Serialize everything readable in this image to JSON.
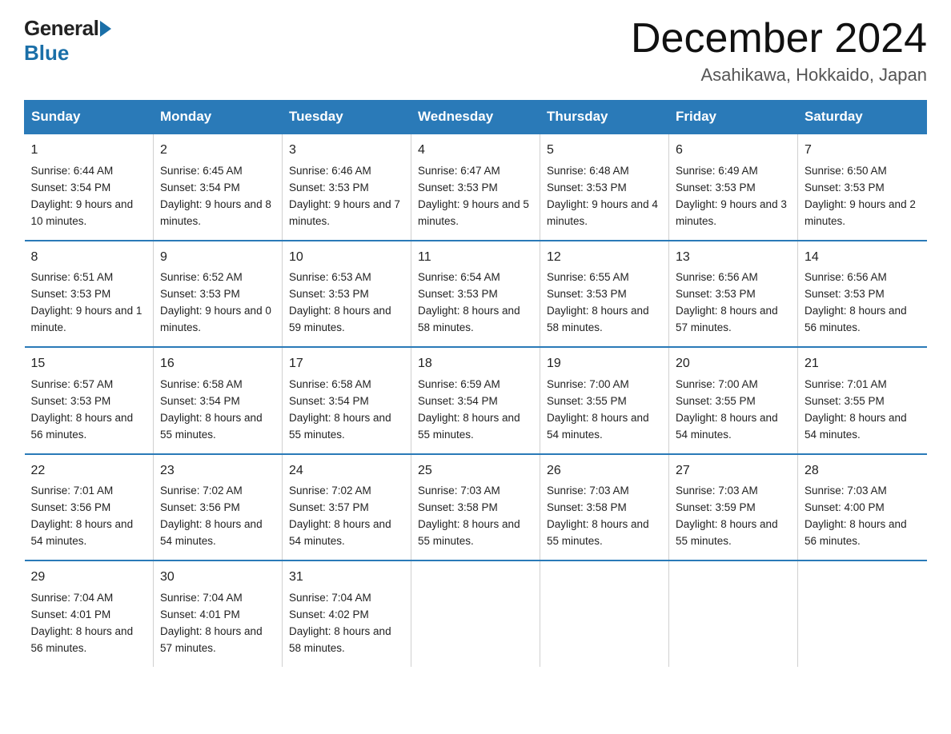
{
  "header": {
    "logo_general": "General",
    "logo_blue": "Blue",
    "month_title": "December 2024",
    "location": "Asahikawa, Hokkaido, Japan"
  },
  "columns": [
    "Sunday",
    "Monday",
    "Tuesday",
    "Wednesday",
    "Thursday",
    "Friday",
    "Saturday"
  ],
  "weeks": [
    [
      {
        "day": "1",
        "sunrise": "6:44 AM",
        "sunset": "3:54 PM",
        "daylight": "9 hours and 10 minutes."
      },
      {
        "day": "2",
        "sunrise": "6:45 AM",
        "sunset": "3:54 PM",
        "daylight": "9 hours and 8 minutes."
      },
      {
        "day": "3",
        "sunrise": "6:46 AM",
        "sunset": "3:53 PM",
        "daylight": "9 hours and 7 minutes."
      },
      {
        "day": "4",
        "sunrise": "6:47 AM",
        "sunset": "3:53 PM",
        "daylight": "9 hours and 5 minutes."
      },
      {
        "day": "5",
        "sunrise": "6:48 AM",
        "sunset": "3:53 PM",
        "daylight": "9 hours and 4 minutes."
      },
      {
        "day": "6",
        "sunrise": "6:49 AM",
        "sunset": "3:53 PM",
        "daylight": "9 hours and 3 minutes."
      },
      {
        "day": "7",
        "sunrise": "6:50 AM",
        "sunset": "3:53 PM",
        "daylight": "9 hours and 2 minutes."
      }
    ],
    [
      {
        "day": "8",
        "sunrise": "6:51 AM",
        "sunset": "3:53 PM",
        "daylight": "9 hours and 1 minute."
      },
      {
        "day": "9",
        "sunrise": "6:52 AM",
        "sunset": "3:53 PM",
        "daylight": "9 hours and 0 minutes."
      },
      {
        "day": "10",
        "sunrise": "6:53 AM",
        "sunset": "3:53 PM",
        "daylight": "8 hours and 59 minutes."
      },
      {
        "day": "11",
        "sunrise": "6:54 AM",
        "sunset": "3:53 PM",
        "daylight": "8 hours and 58 minutes."
      },
      {
        "day": "12",
        "sunrise": "6:55 AM",
        "sunset": "3:53 PM",
        "daylight": "8 hours and 58 minutes."
      },
      {
        "day": "13",
        "sunrise": "6:56 AM",
        "sunset": "3:53 PM",
        "daylight": "8 hours and 57 minutes."
      },
      {
        "day": "14",
        "sunrise": "6:56 AM",
        "sunset": "3:53 PM",
        "daylight": "8 hours and 56 minutes."
      }
    ],
    [
      {
        "day": "15",
        "sunrise": "6:57 AM",
        "sunset": "3:53 PM",
        "daylight": "8 hours and 56 minutes."
      },
      {
        "day": "16",
        "sunrise": "6:58 AM",
        "sunset": "3:54 PM",
        "daylight": "8 hours and 55 minutes."
      },
      {
        "day": "17",
        "sunrise": "6:58 AM",
        "sunset": "3:54 PM",
        "daylight": "8 hours and 55 minutes."
      },
      {
        "day": "18",
        "sunrise": "6:59 AM",
        "sunset": "3:54 PM",
        "daylight": "8 hours and 55 minutes."
      },
      {
        "day": "19",
        "sunrise": "7:00 AM",
        "sunset": "3:55 PM",
        "daylight": "8 hours and 54 minutes."
      },
      {
        "day": "20",
        "sunrise": "7:00 AM",
        "sunset": "3:55 PM",
        "daylight": "8 hours and 54 minutes."
      },
      {
        "day": "21",
        "sunrise": "7:01 AM",
        "sunset": "3:55 PM",
        "daylight": "8 hours and 54 minutes."
      }
    ],
    [
      {
        "day": "22",
        "sunrise": "7:01 AM",
        "sunset": "3:56 PM",
        "daylight": "8 hours and 54 minutes."
      },
      {
        "day": "23",
        "sunrise": "7:02 AM",
        "sunset": "3:56 PM",
        "daylight": "8 hours and 54 minutes."
      },
      {
        "day": "24",
        "sunrise": "7:02 AM",
        "sunset": "3:57 PM",
        "daylight": "8 hours and 54 minutes."
      },
      {
        "day": "25",
        "sunrise": "7:03 AM",
        "sunset": "3:58 PM",
        "daylight": "8 hours and 55 minutes."
      },
      {
        "day": "26",
        "sunrise": "7:03 AM",
        "sunset": "3:58 PM",
        "daylight": "8 hours and 55 minutes."
      },
      {
        "day": "27",
        "sunrise": "7:03 AM",
        "sunset": "3:59 PM",
        "daylight": "8 hours and 55 minutes."
      },
      {
        "day": "28",
        "sunrise": "7:03 AM",
        "sunset": "4:00 PM",
        "daylight": "8 hours and 56 minutes."
      }
    ],
    [
      {
        "day": "29",
        "sunrise": "7:04 AM",
        "sunset": "4:01 PM",
        "daylight": "8 hours and 56 minutes."
      },
      {
        "day": "30",
        "sunrise": "7:04 AM",
        "sunset": "4:01 PM",
        "daylight": "8 hours and 57 minutes."
      },
      {
        "day": "31",
        "sunrise": "7:04 AM",
        "sunset": "4:02 PM",
        "daylight": "8 hours and 58 minutes."
      },
      null,
      null,
      null,
      null
    ]
  ]
}
